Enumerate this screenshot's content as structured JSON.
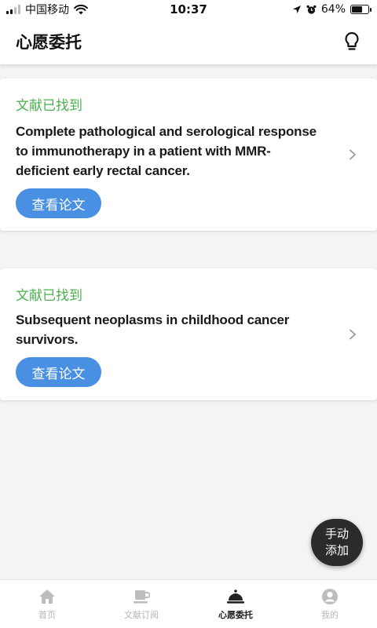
{
  "status_bar": {
    "carrier": "中国移动",
    "time": "10:37",
    "battery_percent": "64%",
    "battery_level": 0.64,
    "icons": [
      "signal-icon",
      "wifi-icon",
      "location-arrow-icon",
      "alarm-clock-icon",
      "battery-icon"
    ]
  },
  "header": {
    "title": "心愿委托",
    "action_icon": "lightbulb-icon"
  },
  "cards": [
    {
      "status": "文献已找到",
      "title": "Complete pathological and serological response to immunotherapy in a patient with MMR-deficient early rectal cancer.",
      "button_label": "查看论文"
    },
    {
      "status": "文献已找到",
      "title": "Subsequent neoplasms in childhood cancer survivors.",
      "button_label": "查看论文"
    }
  ],
  "fab": {
    "line1": "手动",
    "line2": "添加"
  },
  "bottom_nav": {
    "items": [
      {
        "label": "首页",
        "icon": "home-icon",
        "active": false
      },
      {
        "label": "文献订阅",
        "icon": "cup-icon",
        "active": false
      },
      {
        "label": "心愿委托",
        "icon": "service-bell-icon",
        "active": true
      },
      {
        "label": "我的",
        "icon": "user-icon",
        "active": false
      }
    ]
  },
  "colors": {
    "status_green": "#4caf50",
    "button_blue": "#4a90e2",
    "fab_dark": "#2b2b2b",
    "nav_inactive": "#b5b5b5"
  }
}
